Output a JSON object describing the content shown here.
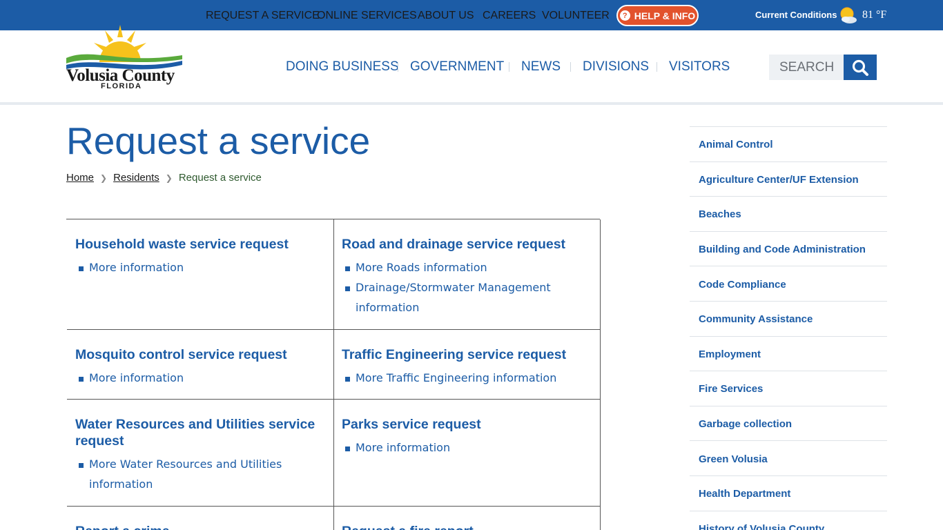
{
  "topbar": {
    "links": [
      "REQUEST A SERVICE",
      "ONLINE SERVICES",
      "ABOUT US",
      "CAREERS",
      "VOLUNTEER"
    ],
    "help": {
      "label": "HELP & INFO",
      "icon": "question-icon"
    },
    "conditions_label": "Current Conditions",
    "weather_icon": "partly-sunny-icon",
    "temperature": "81 °F"
  },
  "header": {
    "logo_name": "Volusia County",
    "logo_state": "FLORIDA",
    "nav": [
      "DOING BUSINESS",
      "GOVERNMENT",
      "NEWS",
      "DIVISIONS",
      "VISITORS"
    ],
    "search_placeholder": "SEARCH",
    "search_icon": "search-icon"
  },
  "page": {
    "title": "Request a service",
    "breadcrumb": [
      "Home",
      "Residents",
      "Request a service"
    ]
  },
  "services": [
    {
      "title": "Household waste service request",
      "links": [
        "More information"
      ]
    },
    {
      "title": "Road and drainage service request",
      "links": [
        "More Roads information",
        "Drainage/Stormwater Management information"
      ]
    },
    {
      "title": "Mosquito control service request",
      "links": [
        "More information"
      ]
    },
    {
      "title": "Traffic Engineering service request",
      "links": [
        "More Traffic Engineering information"
      ]
    },
    {
      "title": "Water Resources and Utilities service request",
      "links": [
        "More Water Resources and Utilities information"
      ]
    },
    {
      "title": "Parks service request",
      "links": [
        "More information"
      ]
    },
    {
      "title": "Report a crime",
      "links": []
    },
    {
      "title": "Request a fire report",
      "links": []
    }
  ],
  "sidebar": {
    "items": [
      "Animal Control",
      "Agriculture Center/UF Extension",
      "Beaches",
      "Building and Code Administration",
      "Code Compliance",
      "Community Assistance",
      "Employment",
      "Fire Services",
      "Garbage collection",
      "Green Volusia",
      "Health Department",
      "History of Volusia County"
    ]
  },
  "colors": {
    "brand_blue": "#1c5ca6",
    "help_orange": "#e2522c",
    "sun_yellow": "#f6c21c",
    "logo_green": "#5aaa3c"
  }
}
